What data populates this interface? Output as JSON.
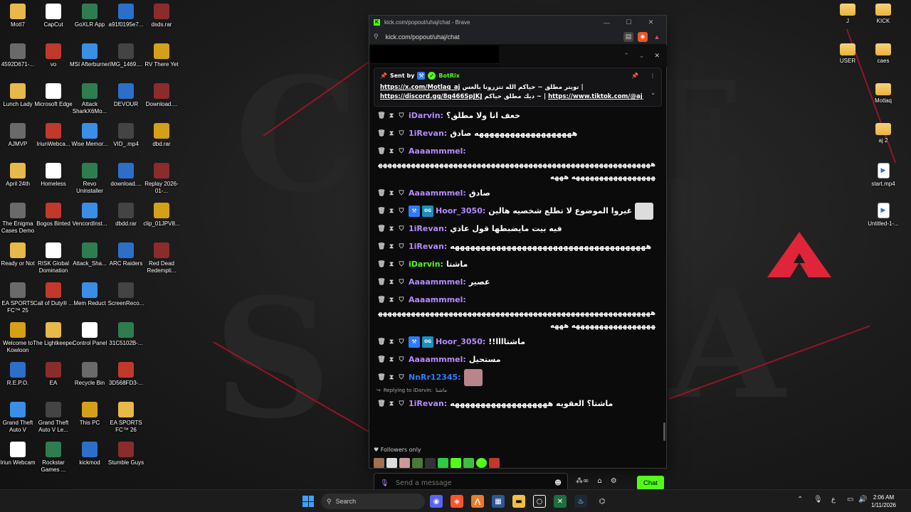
{
  "desktop": {
    "icons": [
      {
        "label": "MotI7"
      },
      {
        "label": "CapCut"
      },
      {
        "label": "GoXLR App"
      },
      {
        "label": "a91f0195e7..."
      },
      {
        "label": "dsds.rar"
      },
      {
        "label": "4592D671-..."
      },
      {
        "label": "vo"
      },
      {
        "label": "MSI Afterburner"
      },
      {
        "label": "IMG_1469...."
      },
      {
        "label": "RV There Yet"
      },
      {
        "label": "Lunch Lady"
      },
      {
        "label": "Microsoft Edge"
      },
      {
        "label": "Attack SharkX6Mo..."
      },
      {
        "label": "DEVOUR"
      },
      {
        "label": "Download...."
      },
      {
        "label": "AJMVP"
      },
      {
        "label": "IriunWebca..."
      },
      {
        "label": "Wise Memor..."
      },
      {
        "label": "VID_.mp4"
      },
      {
        "label": "dbd.rar"
      },
      {
        "label": "April 24th"
      },
      {
        "label": "Homeless"
      },
      {
        "label": "Revo Uninstaller"
      },
      {
        "label": "download...."
      },
      {
        "label": "Replay 2026-01-..."
      },
      {
        "label": "The Enigma Cases Demo"
      },
      {
        "label": "Bogos Binted"
      },
      {
        "label": "VencordInst..."
      },
      {
        "label": "dbdd.rar"
      },
      {
        "label": "clip_01JPV8..."
      },
      {
        "label": "Ready or Not"
      },
      {
        "label": "RISK Global Domination"
      },
      {
        "label": "Attack_Sha..."
      },
      {
        "label": "ARC Raiders"
      },
      {
        "label": "Red Dead Redempti..."
      },
      {
        "label": "EA SPORTS FC™ 25"
      },
      {
        "label": "Call of Duty® ..."
      },
      {
        "label": "Mem Reduct"
      },
      {
        "label": "ScreenReco..."
      },
      {
        "label": "Welcome to Kowloon"
      },
      {
        "label": "The Lightkeeper"
      },
      {
        "label": "Control Panel"
      },
      {
        "label": "31C5102B-..."
      },
      {
        "label": "R.E.P.O."
      },
      {
        "label": "EA"
      },
      {
        "label": "Recycle Bin"
      },
      {
        "label": "3D568FD3-..."
      },
      {
        "label": "Grand Theft Auto V"
      },
      {
        "label": "Grand Theft Auto V Le..."
      },
      {
        "label": "This PC"
      },
      {
        "label": "EA SPORTS FC™ 26"
      },
      {
        "label": "Iriun Webcam"
      },
      {
        "label": "Rockstar Games ..."
      },
      {
        "label": "kickmod"
      },
      {
        "label": "Stumble Guys"
      }
    ],
    "right_icons": [
      {
        "label": "J"
      },
      {
        "label": "KICK"
      },
      {
        "label": "USER"
      },
      {
        "label": "caes"
      },
      {
        "label": "Motlaq"
      },
      {
        "label": "aj 2"
      },
      {
        "label": "start.mp4"
      },
      {
        "label": "Untitled-1-..."
      }
    ]
  },
  "browser": {
    "title": "kick.com/popout/uhaj/chat - Brave",
    "url": "kick.com/popout/uhaj/chat",
    "window_buttons": [
      "—",
      "☐",
      "✕"
    ]
  },
  "pinned": {
    "sent_by_label": "Sent by",
    "bot_name": "BotRix",
    "line1_text": "تويتر مطلق ~ حياكم الله تتزرونا بالعس |",
    "line1_link": "https://x.com/Motlaq_aj",
    "line2_link1": "https://discord.gg/8q466SpJKJ",
    "line2_text": "ديك مطلق حياكم ~",
    "line2_link2": "https://www.tiktok.com/@aj_155..."
  },
  "messages": [
    {
      "user": "iDarvin",
      "color": "#b58bff",
      "text": "خعف انا ولا مطلق؟"
    },
    {
      "user": "1iRevan",
      "color": "#b58bff",
      "text": "هههههههههههههههههههه صادق"
    },
    {
      "user": "Aaaammmel",
      "color": "#b58bff",
      "text": "",
      "wrap": "ههههههههههههههههههههههههههههههههههههههههههههههههههههههههههههههههههههههههههههه هههه"
    },
    {
      "user": "Aaaammmel",
      "color": "#b58bff",
      "text": "صادق"
    },
    {
      "user": "Hoor_3050",
      "color": "#b58bff",
      "text": "غيروا الموضوع لا تطلع شخصيه هالين",
      "badges": true
    },
    {
      "user": "1iRevan",
      "color": "#b58bff",
      "text": "فيه بيت مايضبطها قول عادي"
    },
    {
      "user": "1iRevan",
      "color": "#b58bff",
      "text": "ههههههههههههههههههههههههههههههههههههههه"
    },
    {
      "user": "iDarvin",
      "color": "#53fc18",
      "text": "ماشتا"
    },
    {
      "user": "Aaaammmel",
      "color": "#b58bff",
      "text": "عصير"
    },
    {
      "user": "Aaaammmel",
      "color": "#b58bff",
      "text": "",
      "wrap": "ههههههههههههههههههههههههههههههههههههههههههههههههههههههههههههههههههههههههههههه هههه"
    },
    {
      "user": "Hoor_3050",
      "color": "#b58bff",
      "text": "ماشتاااا!!",
      "badges": true
    },
    {
      "user": "Aaaammmel",
      "color": "#b58bff",
      "text": "مستحيل"
    },
    {
      "user": "NnRr12345",
      "color": "#2d7bff",
      "text": ""
    },
    {
      "user": "1iRevan",
      "color": "#b58bff",
      "text": "ماشتا؟ العقويه هههههههههههههههههههه"
    }
  ],
  "reply_label": "Replying to iDarvin:",
  "reply_snippet": "ماشتا",
  "followers_label": "Followers only",
  "input_placeholder": "Send a message",
  "chat_button": "Chat",
  "taskbar": {
    "search_label": "Search",
    "lang": "ع",
    "time": "2:06 AM",
    "date": "1/11/2026"
  },
  "colors": {
    "kick_green": "#53fc18",
    "accent_purple": "#b58bff",
    "apex_red": "#e0243a"
  }
}
